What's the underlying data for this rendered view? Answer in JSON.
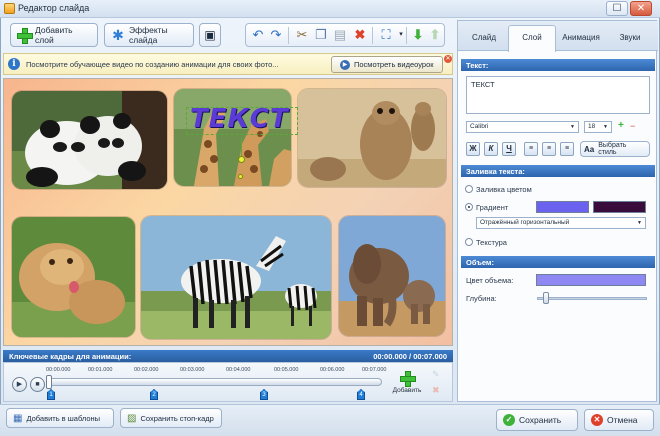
{
  "window": {
    "title": "Редактор слайда"
  },
  "toolbar": {
    "add_layer": "Добавить слой",
    "slide_effects": "Эффекты слайда"
  },
  "info": {
    "text": "Посмотрите обучающее видео по созданию анимации для своих фото...",
    "watch_video": "Посмотреть видеоурок"
  },
  "canvas": {
    "text_layer": "ТЕКСТ"
  },
  "keyframes": {
    "header": "Ключевые кадры для анимации:",
    "time": "00:00.000 / 00:07.000",
    "ticks": [
      "00:00.000",
      "00:01.000",
      "00:02.000",
      "00:03.000",
      "00:04.000",
      "00:05.000",
      "00:06.000",
      "00:07.000"
    ],
    "markers": [
      "1",
      "2",
      "3",
      "4"
    ],
    "add_label": "Добавить"
  },
  "panel": {
    "tabs": [
      "Слайд",
      "Слой",
      "Анимация",
      "Звуки"
    ],
    "active_tab": "Слой",
    "text_section": "Текст:",
    "text_value": "ТЕКСТ",
    "font": "Calibri",
    "font_size": "18",
    "format_buttons": [
      "Ж",
      "К",
      "Ч"
    ],
    "choose_style": "Выбрать стиль",
    "fill_section": "Заливка текста:",
    "fill_color": "Заливка цветом",
    "gradient": "Градиент",
    "gradient_type": "Отражённый горизонтальный",
    "texture": "Текстура",
    "gradient_color_1": "#6b63f0",
    "gradient_color_2": "#3a0c3c",
    "volume_section": "Объем:",
    "volume_color_label": "Цвет объема:",
    "volume_color": "#8f88f2",
    "depth_label": "Глубина:"
  },
  "bottom": {
    "add_template": "Добавить в шаблоны",
    "save_frame": "Сохранить стоп-кадр",
    "save": "Сохранить",
    "cancel": "Отмена"
  }
}
